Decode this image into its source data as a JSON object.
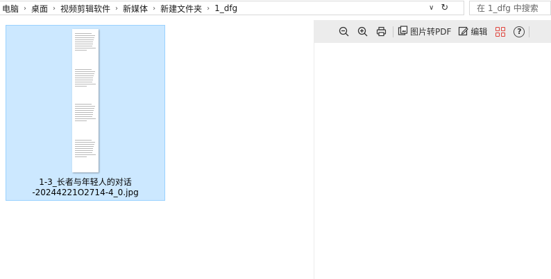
{
  "breadcrumb": {
    "items": [
      "电脑",
      "桌面",
      "视频剪辑软件",
      "新媒体",
      "新建文件夹",
      "1_dfg"
    ],
    "separator": "›"
  },
  "address_controls": {
    "dropdown_icon": "chevron-down-icon",
    "refresh_icon": "refresh-icon"
  },
  "search": {
    "placeholder": "在 1_dfg 中搜索"
  },
  "file": {
    "name_line1": "1-3_长者与年轻人的对话",
    "name_line2": "-20244221O2714-4_0.jpg",
    "selected": true
  },
  "toolbar": {
    "zoom_out_icon": "zoom-out-icon",
    "zoom_in_icon": "zoom-in-icon",
    "print_icon": "print-icon",
    "convert_label": "图片转PDF",
    "edit_label": "编辑",
    "apps_icon": "apps-grid-icon",
    "help_label": "?"
  },
  "colors": {
    "selection_bg": "#cce8ff",
    "selection_border": "#99d1ff",
    "toolbar_bg": "#ececec",
    "apps_icon": "#e0433b"
  }
}
